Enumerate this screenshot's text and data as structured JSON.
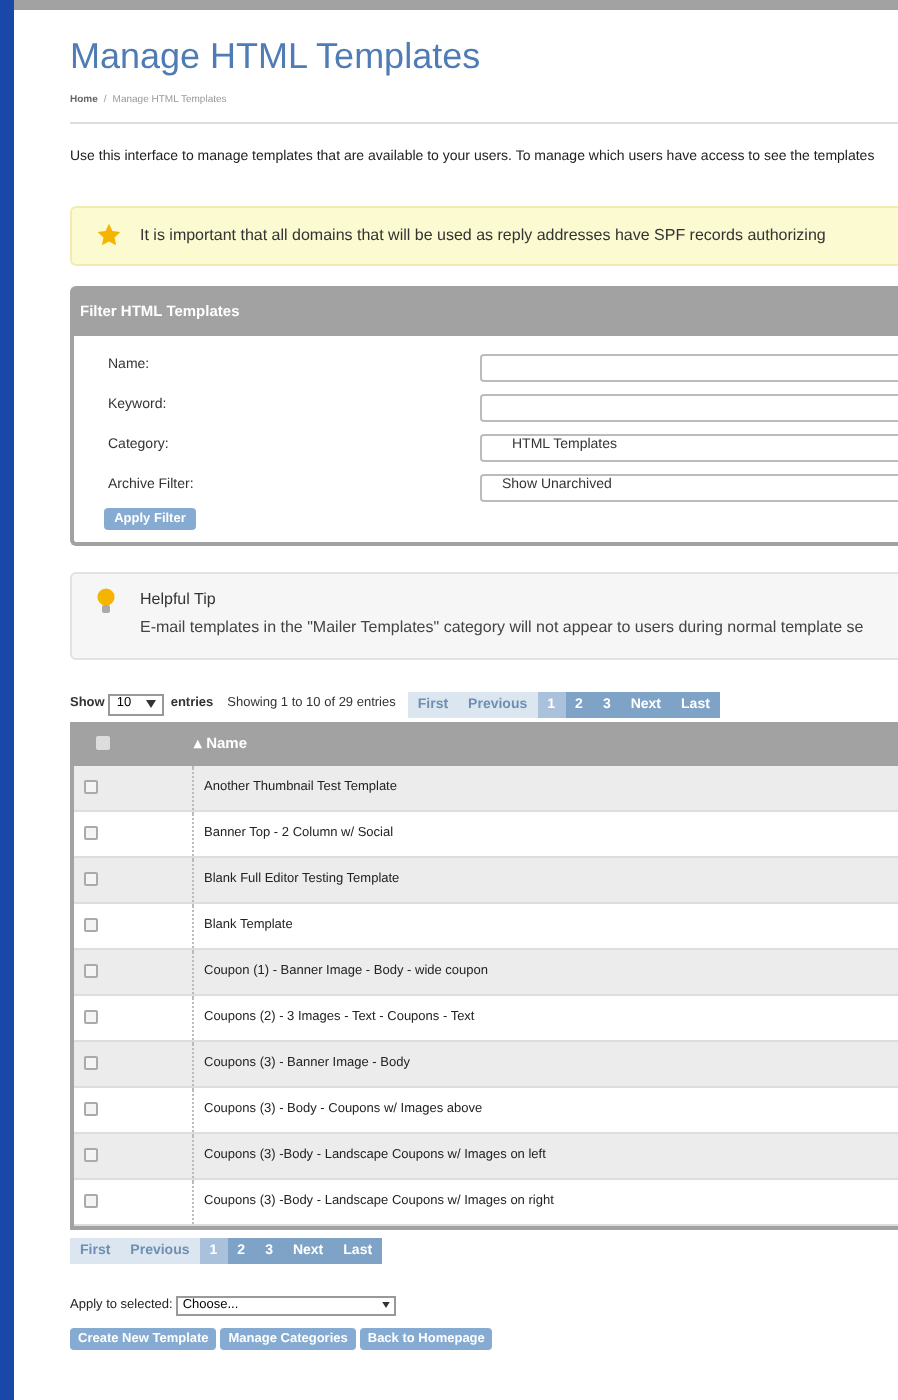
{
  "page": {
    "title": "Manage HTML Templates",
    "breadcrumb": [
      {
        "label": "Home"
      },
      {
        "label": "Manage HTML Templates"
      }
    ],
    "breadcrumb_separator": "/",
    "intro": "Use this interface to manage templates that are available to your users. To manage which users have access to see the templates"
  },
  "alert": {
    "text": "It is important that all domains that will be used as reply addresses have SPF records authorizing"
  },
  "filter": {
    "title": "Filter HTML Templates",
    "fields": [
      {
        "label": "Name:",
        "kind": "text"
      },
      {
        "label": "Keyword:",
        "kind": "text"
      },
      {
        "label": "Category:",
        "kind": "select",
        "value": "HTML Templates"
      },
      {
        "label": "Archive Filter:",
        "kind": "select",
        "value": "Show Unarchived"
      }
    ],
    "apply": "Apply Filter"
  },
  "tip": {
    "title": "Helpful Tip",
    "text": "E-mail templates in the \"Mailer Templates\" category will not appear to users during normal template se"
  },
  "table_controls": {
    "show": "Show",
    "page_size": "10",
    "entries": "entries",
    "info": "Showing 1 to 10 of 29 entries"
  },
  "pagination_top": [
    {
      "label": "First",
      "disabled": true,
      "selected": false
    },
    {
      "label": "Previous",
      "disabled": true,
      "selected": false
    },
    {
      "label": "1",
      "disabled": false,
      "selected": true
    },
    {
      "label": "2",
      "disabled": false,
      "selected": false
    },
    {
      "label": "3",
      "disabled": false,
      "selected": false
    },
    {
      "label": "Next",
      "disabled": false,
      "selected": false
    },
    {
      "label": "Last",
      "disabled": false,
      "selected": false
    }
  ],
  "table": {
    "all_checked": false,
    "columns": [
      {
        "label": "Name",
        "sort_mark": "▴"
      }
    ],
    "rows": [
      {
        "name": "Another Thumbnail Test Template",
        "checked": false
      },
      {
        "name": "Banner Top - 2 Column w/ Social",
        "checked": false
      },
      {
        "name": "Blank Full Editor Testing Template",
        "checked": false
      },
      {
        "name": "Blank Template",
        "checked": false
      },
      {
        "name": "Coupon (1) - Banner Image - Body - wide coupon",
        "checked": false
      },
      {
        "name": "Coupons (2) - 3 Images - Text - Coupons - Text",
        "checked": false
      },
      {
        "name": "Coupons (3) - Banner Image - Body",
        "checked": false
      },
      {
        "name": "Coupons (3) - Body - Coupons w/ Images above",
        "checked": false
      },
      {
        "name": "Coupons (3) -Body - Landscape Coupons w/ Images on left",
        "checked": false
      },
      {
        "name": "Coupons (3) -Body - Landscape Coupons w/ Images on right",
        "checked": false
      }
    ]
  },
  "pagination_bottom": [
    {
      "label": "First",
      "disabled": true,
      "selected": false
    },
    {
      "label": "Previous",
      "disabled": true,
      "selected": false
    },
    {
      "label": "1",
      "disabled": false,
      "selected": true
    },
    {
      "label": "2",
      "disabled": false,
      "selected": false
    },
    {
      "label": "3",
      "disabled": false,
      "selected": false
    },
    {
      "label": "Next",
      "disabled": false,
      "selected": false
    },
    {
      "label": "Last",
      "disabled": false,
      "selected": false
    }
  ],
  "bulk": {
    "label": "Apply to selected:",
    "value": "Choose..."
  },
  "buttons": [
    "Create New Template",
    "Manage Categories",
    "Back to Homepage"
  ]
}
